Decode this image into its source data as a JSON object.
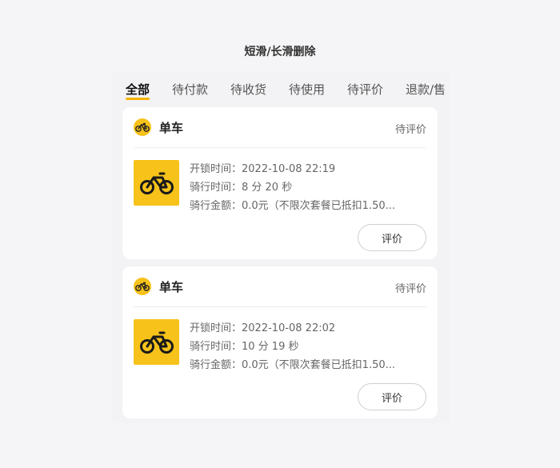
{
  "page_title": "短滑/长滑删除",
  "tabs": [
    {
      "label": "全部",
      "active": true
    },
    {
      "label": "待付款",
      "active": false
    },
    {
      "label": "待收货",
      "active": false
    },
    {
      "label": "待使用",
      "active": false
    },
    {
      "label": "待评价",
      "active": false
    },
    {
      "label": "退款/售",
      "active": false
    }
  ],
  "orders": [
    {
      "brand": "单车",
      "status": "待评价",
      "unlock_time": "开锁时间：2022-10-08 22:19",
      "ride_time": "骑行时间：8 分 20 秒",
      "amount": "骑行金额：0.0元（不限次套餐已抵扣1.50...",
      "action": "评价"
    },
    {
      "brand": "单车",
      "status": "待评价",
      "unlock_time": "开锁时间：2022-10-08 22:02",
      "ride_time": "骑行时间：10 分 19 秒",
      "amount": "骑行金额：0.0元（不限次套餐已抵扣1.50...",
      "action": "评价"
    }
  ],
  "colors": {
    "accent": "#f7c21a",
    "tab_underline": "#f5b400",
    "card_bg": "#ffffff",
    "page_bg": "#f5f5f7"
  },
  "icons": {
    "brand": "bicycle-icon",
    "thumbnail": "bicycle-icon"
  }
}
